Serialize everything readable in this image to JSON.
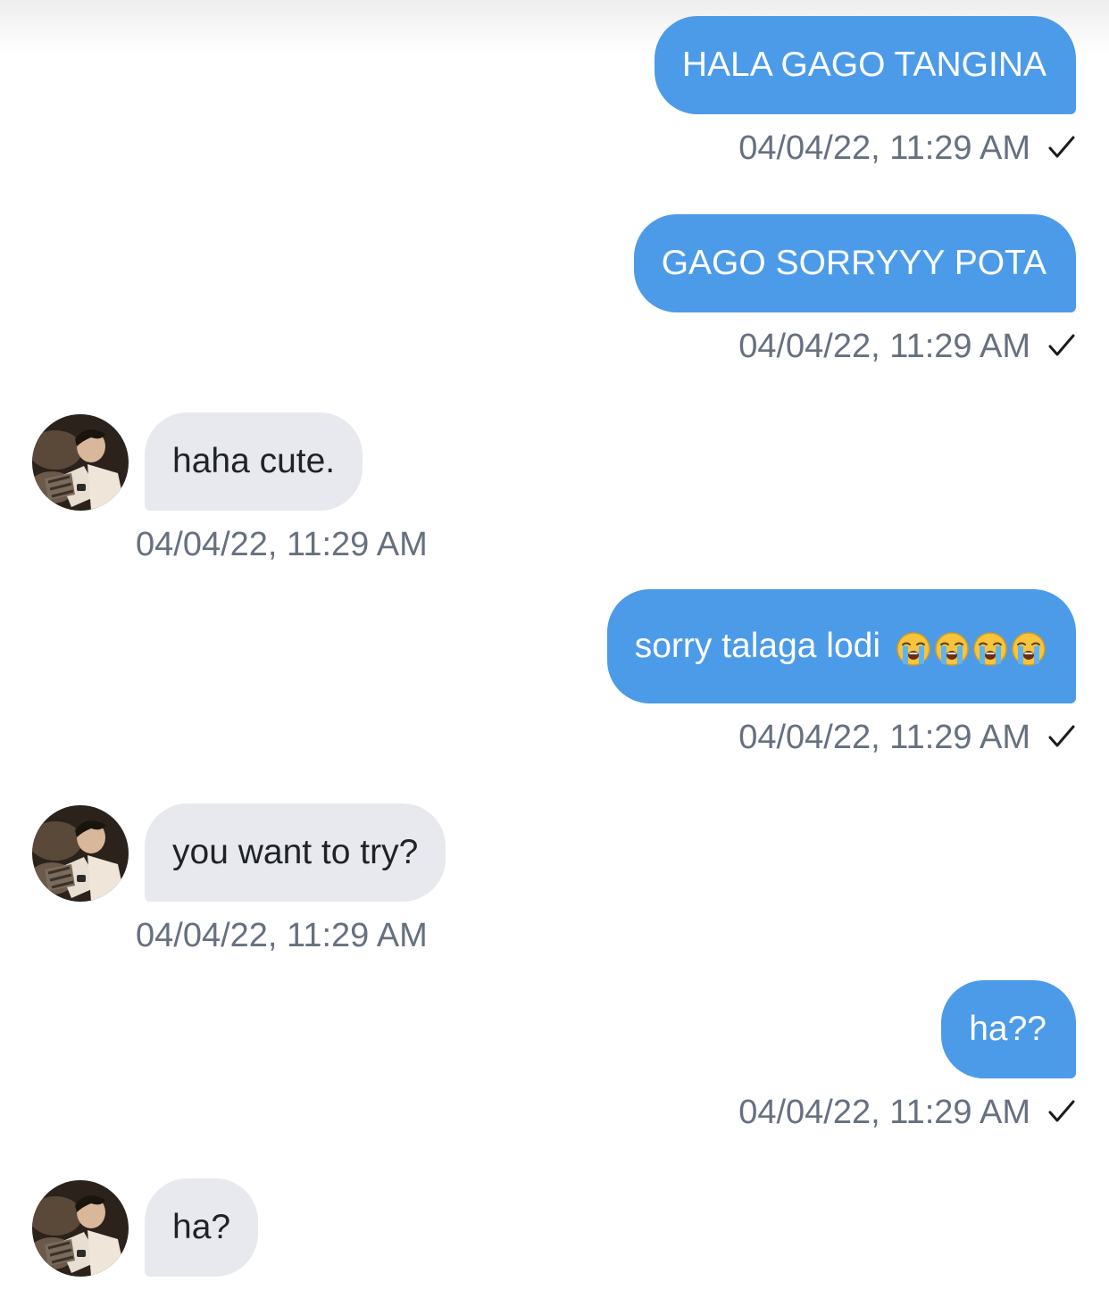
{
  "conversation": {
    "messages": [
      {
        "sender": "me",
        "text": "HALA GAGO TANGINA",
        "timestamp": "04/04/22, 11:29 AM",
        "status": "sent"
      },
      {
        "sender": "me",
        "text": "GAGO SORRYYY POTA",
        "timestamp": "04/04/22, 11:29 AM",
        "status": "sent"
      },
      {
        "sender": "them",
        "text": "haha cute.",
        "timestamp": "04/04/22, 11:29 AM"
      },
      {
        "sender": "me",
        "text": "sorry talaga lodi",
        "emoji": [
          "loudly-crying-face",
          "loudly-crying-face",
          "loudly-crying-face",
          "loudly-crying-face"
        ],
        "timestamp": "04/04/22, 11:29 AM",
        "status": "sent"
      },
      {
        "sender": "them",
        "text": "you want to try?",
        "timestamp": "04/04/22, 11:29 AM"
      },
      {
        "sender": "me",
        "text": "ha??",
        "timestamp": "04/04/22, 11:29 AM",
        "status": "sent"
      },
      {
        "sender": "them",
        "text": "ha?"
      }
    ]
  },
  "icons": {
    "sent_status": "checkmark-icon",
    "contact_avatar": "avatar"
  },
  "colors": {
    "sent_bubble": "#4c9be8",
    "received_bubble": "#e7e9ee",
    "timestamp": "#667080",
    "background": "#ffffff"
  }
}
